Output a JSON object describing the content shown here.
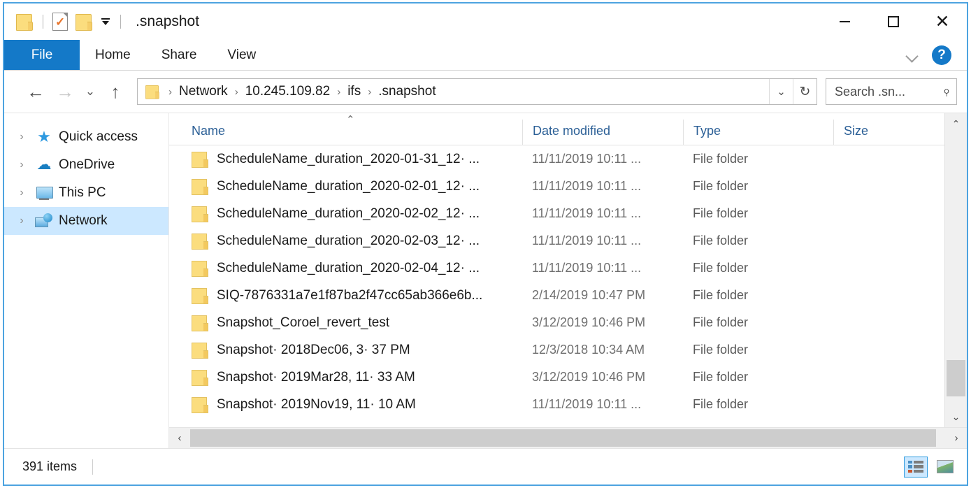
{
  "window": {
    "title": ".snapshot",
    "minimize_label": "Minimize",
    "maximize_label": "Maximize",
    "close_label": "Close"
  },
  "quick_access_toolbar": {
    "folder_icon": "folder-icon",
    "properties_icon": "properties-icon",
    "new_folder_icon": "new-folder-icon",
    "customize_icon": "customize-dropdown-icon"
  },
  "ribbon": {
    "tabs": [
      {
        "label": "File",
        "selected": true
      },
      {
        "label": "Home",
        "selected": false
      },
      {
        "label": "Share",
        "selected": false
      },
      {
        "label": "View",
        "selected": false
      }
    ],
    "expand_icon": "chevron-down-icon",
    "help_label": "?"
  },
  "address_bar": {
    "back_icon": "←",
    "forward_icon": "→",
    "recent_icon": "⌄",
    "up_icon": "↑",
    "breadcrumbs": [
      "Network",
      "10.245.109.82",
      "ifs",
      ".snapshot"
    ],
    "separator": "›",
    "dropdown_icon": "⌄",
    "refresh_icon": "↻"
  },
  "search": {
    "placeholder": "Search .sn...",
    "icon": "search-icon"
  },
  "sidebar": {
    "items": [
      {
        "label": "Quick access",
        "icon": "star-icon",
        "selected": false
      },
      {
        "label": "OneDrive",
        "icon": "cloud-icon",
        "selected": false
      },
      {
        "label": "This PC",
        "icon": "monitor-icon",
        "selected": false
      },
      {
        "label": "Network",
        "icon": "network-icon",
        "selected": true
      }
    ],
    "expand_chevron": "›"
  },
  "file_list": {
    "columns": [
      {
        "label": "Name",
        "sorted": "asc"
      },
      {
        "label": "Date modified",
        "sorted": null
      },
      {
        "label": "Type",
        "sorted": null
      },
      {
        "label": "Size",
        "sorted": null
      }
    ],
    "sort_caret": "⌃",
    "rows": [
      {
        "name": "ScheduleName_duration_2020-01-31_12· ...",
        "date": "11/11/2019 10:11 ...",
        "type": "File folder",
        "size": ""
      },
      {
        "name": "ScheduleName_duration_2020-02-01_12· ...",
        "date": "11/11/2019 10:11 ...",
        "type": "File folder",
        "size": ""
      },
      {
        "name": "ScheduleName_duration_2020-02-02_12· ...",
        "date": "11/11/2019 10:11 ...",
        "type": "File folder",
        "size": ""
      },
      {
        "name": "ScheduleName_duration_2020-02-03_12· ...",
        "date": "11/11/2019 10:11 ...",
        "type": "File folder",
        "size": ""
      },
      {
        "name": "ScheduleName_duration_2020-02-04_12· ...",
        "date": "11/11/2019 10:11 ...",
        "type": "File folder",
        "size": ""
      },
      {
        "name": "SIQ-7876331a7e1f87ba2f47cc65ab366e6b...",
        "date": "2/14/2019 10:47 PM",
        "type": "File folder",
        "size": ""
      },
      {
        "name": "Snapshot_Coroel_revert_test",
        "date": "3/12/2019 10:46 PM",
        "type": "File folder",
        "size": ""
      },
      {
        "name": "Snapshot· 2018Dec06, 3· 37 PM",
        "date": "12/3/2018 10:34 AM",
        "type": "File folder",
        "size": ""
      },
      {
        "name": "Snapshot· 2019Mar28, 11· 33 AM",
        "date": "3/12/2019 10:46 PM",
        "type": "File folder",
        "size": ""
      },
      {
        "name": "Snapshot· 2019Nov19, 11· 10 AM",
        "date": "11/11/2019 10:11 ...",
        "type": "File folder",
        "size": ""
      }
    ]
  },
  "scrollbars": {
    "vertical_up": "⌃",
    "vertical_down": "⌄",
    "horizontal_left": "‹",
    "horizontal_right": "›"
  },
  "status_bar": {
    "item_count": "391 items",
    "details_view_label": "Details view",
    "icons_view_label": "Large icons view"
  },
  "colors": {
    "accent": "#1479c8",
    "selection": "#cce8ff",
    "window_border": "#4da3e0",
    "folder_yellow": "#fbdd7e",
    "header_text": "#2b5f96"
  }
}
